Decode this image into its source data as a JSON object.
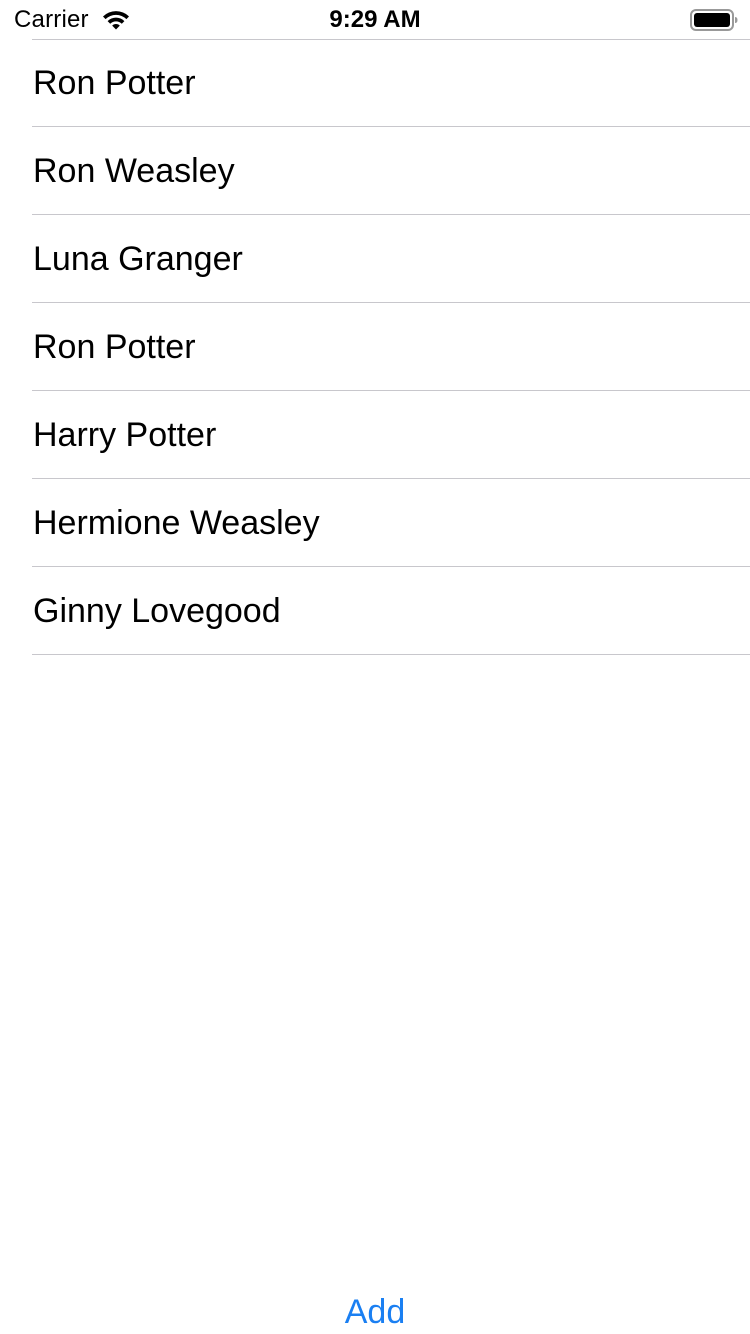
{
  "status_bar": {
    "carrier": "Carrier",
    "time": "9:29 AM",
    "wifi_icon": "wifi-icon",
    "battery_icon": "battery-icon"
  },
  "list": {
    "items": [
      {
        "label": "Ron Potter"
      },
      {
        "label": "Ron Weasley"
      },
      {
        "label": "Luna Granger"
      },
      {
        "label": "Ron Potter"
      },
      {
        "label": "Harry Potter"
      },
      {
        "label": "Hermione Weasley"
      },
      {
        "label": "Ginny Lovegood"
      }
    ]
  },
  "toolbar": {
    "add_label": "Add"
  },
  "colors": {
    "accent": "#1a7ff2",
    "separator": "#c8c7cc",
    "text": "#000000",
    "background": "#ffffff"
  }
}
